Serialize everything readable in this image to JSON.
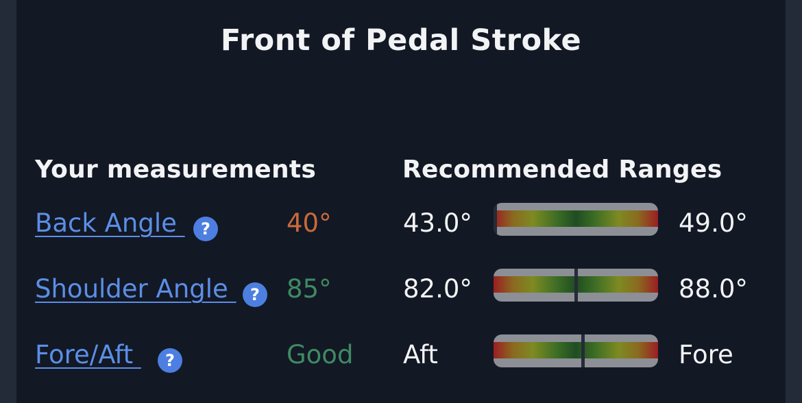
{
  "title": "Front of Pedal Stroke",
  "headers": {
    "measurements": "Your measurements",
    "ranges": "Recommended Ranges"
  },
  "help_glyph": "?",
  "rows": [
    {
      "label": "Back Angle ",
      "value": "40°",
      "value_color": "#c96a3a",
      "range_min": "43.0°",
      "range_max": "49.0°",
      "gauge_position": 0.0
    },
    {
      "label": "Shoulder Angle ",
      "value": "85°",
      "value_color": "#3f8a62",
      "range_min": "82.0°",
      "range_max": "88.0°",
      "gauge_position": 0.5
    },
    {
      "label": "Fore/Aft ",
      "value": "Good",
      "value_color": "#3f8a62",
      "range_min": "Aft",
      "range_max": "Fore",
      "gauge_position": 0.54
    }
  ]
}
